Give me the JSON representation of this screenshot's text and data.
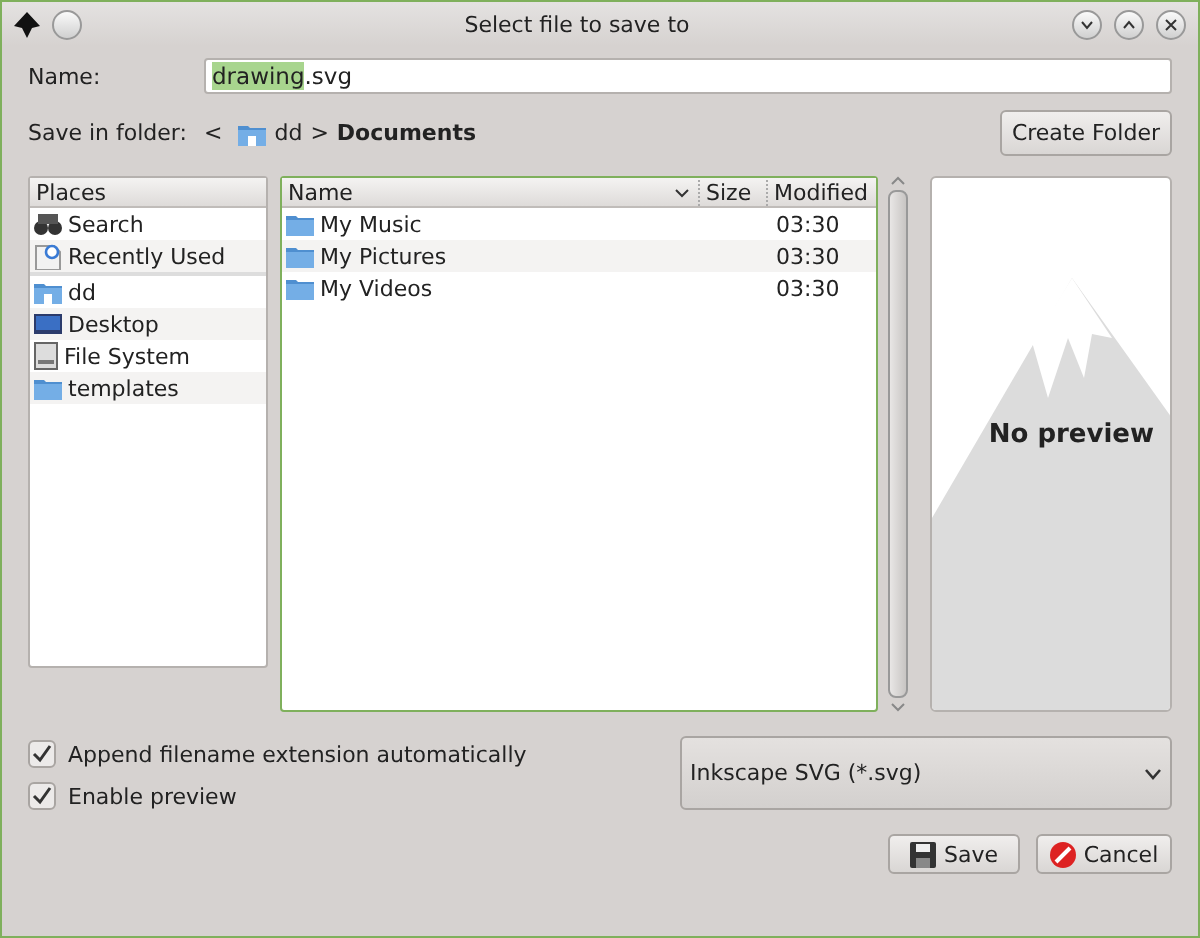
{
  "window": {
    "title": "Select file to save to"
  },
  "name_field": {
    "label": "Name:",
    "selected_text": "drawing",
    "text": ".svg"
  },
  "folder": {
    "label": "Save in folder:",
    "back": "<",
    "path": [
      {
        "name": "dd",
        "current": false
      },
      {
        "name": "Documents",
        "current": true
      }
    ],
    "separator": ">",
    "create_button": "Create Folder"
  },
  "places": {
    "header": "Places",
    "items": [
      {
        "label": "Search",
        "kind": "search"
      },
      {
        "label": "Recently Used",
        "kind": "recent"
      },
      {
        "label": "dd",
        "kind": "home"
      },
      {
        "label": "Desktop",
        "kind": "desktop"
      },
      {
        "label": "File System",
        "kind": "drive"
      },
      {
        "label": "templates",
        "kind": "folder"
      }
    ]
  },
  "files": {
    "columns": [
      "Name",
      "Size",
      "Modified"
    ],
    "rows": [
      {
        "name": "My Music",
        "size": "",
        "modified": "03:30"
      },
      {
        "name": "My Pictures",
        "size": "",
        "modified": "03:30"
      },
      {
        "name": "My Videos",
        "size": "",
        "modified": "03:30"
      }
    ]
  },
  "preview": {
    "text": "No preview"
  },
  "options": [
    {
      "label": "Append filename extension automatically",
      "checked": true
    },
    {
      "label": "Enable preview",
      "checked": true
    }
  ],
  "file_type": "Inkscape SVG (*.svg)",
  "buttons": [
    {
      "label": "Save",
      "kind": "save"
    },
    {
      "label": "Cancel",
      "kind": "cancel"
    }
  ]
}
